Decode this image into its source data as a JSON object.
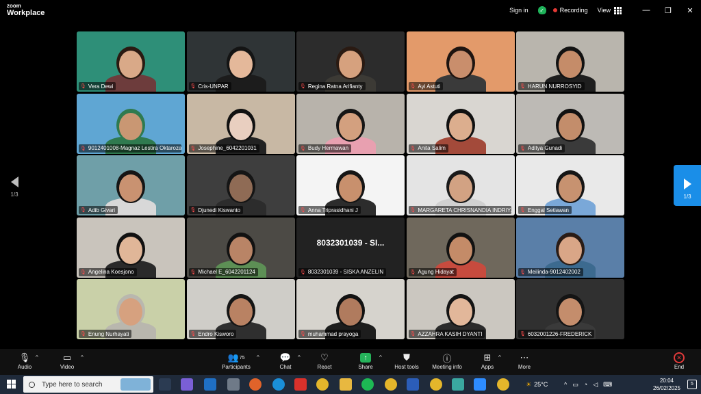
{
  "app": {
    "brand_top": "zoom",
    "brand_bottom": "Workplace"
  },
  "titlebar": {
    "signin": "Sign in",
    "recording": "Recording",
    "view": "View",
    "minimize": "—",
    "restore": "❐",
    "close": "✕"
  },
  "participants": [
    {
      "name": "Vera Dewi",
      "bg": "#2e8f78",
      "skin": "#d9a988",
      "hair": "#2a1a12",
      "shirt": "#6d3c3c"
    },
    {
      "name": "Cris-UNPAR",
      "bg": "#2f3436",
      "skin": "#e4b89a",
      "hair": "#141414",
      "shirt": "#1c1c1c"
    },
    {
      "name": "Regina Ratna Arifianty",
      "bg": "#2c2c2c",
      "skin": "#d6a17e",
      "hair": "#2a1a12",
      "shirt": "#3c3a35"
    },
    {
      "name": "Ayi Astuti",
      "bg": "#e39a6a",
      "skin": "#c98e6c",
      "hair": "#1e1410",
      "shirt": "#3a3a3a"
    },
    {
      "name": "HARUN NURROSYID",
      "bg": "#b9b5ad",
      "skin": "#c58c69",
      "hair": "#121212",
      "shirt": "#1e1e1e"
    },
    {
      "name": "9012401008-Magnaz Lestira Oktaroza",
      "bg": "#5fa6d3",
      "skin": "#c99773",
      "hair": "#2f7a4f",
      "shirt": "#2f7a4f"
    },
    {
      "name": "Josephine_6042201031",
      "bg": "#c8b8a4",
      "skin": "#e9cfc0",
      "hair": "#111111",
      "shirt": "#222222"
    },
    {
      "name": "Budy Hermawan",
      "bg": "#b8b3ab",
      "skin": "#d3a07f",
      "hair": "#161616",
      "shirt": "#e8a0b0"
    },
    {
      "name": "Anita Salim",
      "bg": "#d9d6d1",
      "skin": "#dcae8e",
      "hair": "#111111",
      "shirt": "#a34a3a"
    },
    {
      "name": "Aditya Gunadi",
      "bg": "#bdbab5",
      "skin": "#c38d6b",
      "hair": "#111111",
      "shirt": "#3a3a3a"
    },
    {
      "name": "Adib Givari",
      "bg": "#6f9fa8",
      "skin": "#c99271",
      "hair": "#151515",
      "shirt": "#d8d8d8"
    },
    {
      "name": "Djunedi Kiswanto",
      "bg": "#3e3e3e",
      "skin": "#8f6b55",
      "hair": "#151515",
      "shirt": "#2c2c2c"
    },
    {
      "name": "Anna Triprasidhani J",
      "bg": "#f4f4f4",
      "skin": "#c8906d",
      "hair": "#151515",
      "shirt": "#2c2c2c"
    },
    {
      "name": "MARGARETA CHRISNANDIA INDRIY...",
      "bg": "#e4e4e4",
      "skin": "#d2a283",
      "hair": "#1a1a1a",
      "shirt": "#d0d0d0"
    },
    {
      "name": "Enggal Setiawan",
      "bg": "#e9e9e9",
      "skin": "#c79270",
      "hair": "#151515",
      "shirt": "#7aa8d8"
    },
    {
      "name": "Angelina Koesjono",
      "bg": "#c9c4bc",
      "skin": "#e0b698",
      "hair": "#111111",
      "shirt": "#2a2a2a"
    },
    {
      "name": "Michael E_6042201124",
      "bg": "#4c4a45",
      "skin": "#b98466",
      "hair": "#121212",
      "shirt": "#5d8f55"
    },
    {
      "name": "8032301039 - SISKA ANZELIN",
      "bg": "#222222",
      "display_text": "8032301039 - SI..."
    },
    {
      "name": "Agung Hidayat",
      "bg": "#6f685c",
      "skin": "#c48b68",
      "hair": "#121212",
      "shirt": "#c74b3e"
    },
    {
      "name": "Meilinda-9012402002",
      "bg": "#5a7fa8",
      "skin": "#d9a687",
      "hair": "#2a1c16",
      "shirt": "#3c6a8f"
    },
    {
      "name": "Enung Nurhayati",
      "bg": "#c9d0a8",
      "skin": "#d6a17f",
      "hair": "#b9b7ae",
      "shirt": "#b9b7ae"
    },
    {
      "name": "Endro Kisworo",
      "bg": "#cfcdc8",
      "skin": "#b98263",
      "hair": "#151515",
      "shirt": "#2f2f2f"
    },
    {
      "name": "muhammad prayoga",
      "bg": "#d6d3cd",
      "skin": "#b07b5e",
      "hair": "#121212",
      "shirt": "#1d1d1d"
    },
    {
      "name": "AZZAHRA KASIH DYANTI",
      "bg": "#cbc7c0",
      "skin": "#e2b79a",
      "hair": "#141414",
      "shirt": "#2b2b2b"
    },
    {
      "name": "6032001226-FREDERICK",
      "bg": "#303030",
      "skin": "#c48d6c",
      "hair": "#141414",
      "shirt": "#3a3a3a"
    }
  ],
  "pager": {
    "left_page": "1/3",
    "right_page": "1/3"
  },
  "toolbar": {
    "audio": "Audio",
    "video": "Video",
    "participants": "Participants",
    "participants_count": "75",
    "chat": "Chat",
    "react": "React",
    "share": "Share",
    "host_tools": "Host tools",
    "meeting_info": "Meeting info",
    "apps": "Apps",
    "more": "More",
    "end": "End"
  },
  "taskbar": {
    "search_placeholder": "Type here to search",
    "temperature": "25°C",
    "time": "20:04",
    "date": "26/02/2025",
    "notifications": "5"
  }
}
